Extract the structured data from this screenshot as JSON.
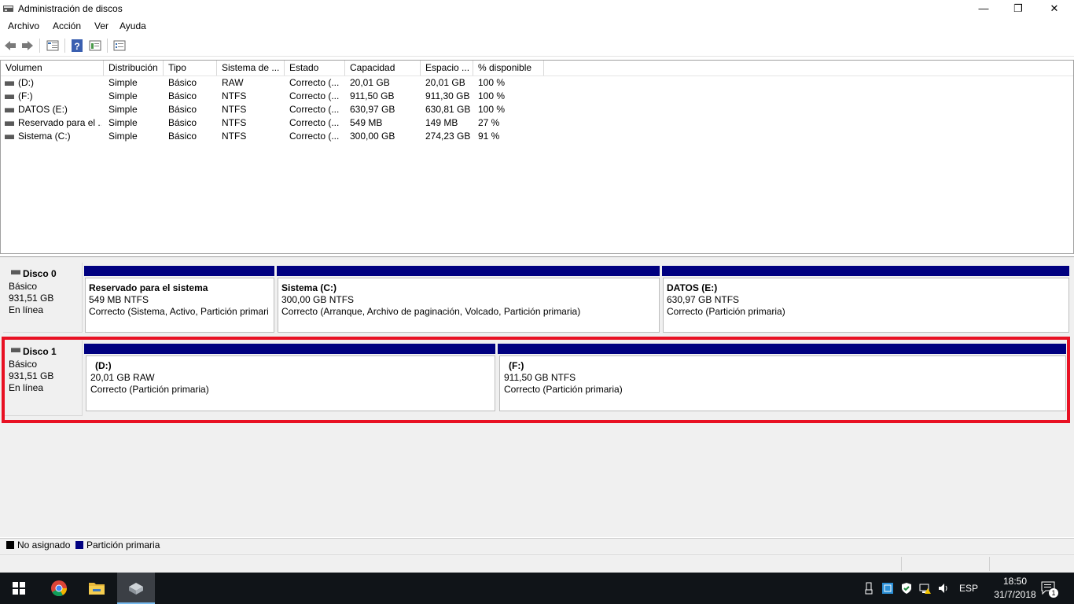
{
  "window": {
    "title": "Administración de discos",
    "minimize_glyph": "—",
    "maximize_glyph": "❐",
    "close_glyph": "✕"
  },
  "menu": {
    "items": [
      {
        "label": "Archivo"
      },
      {
        "label": "Acción"
      },
      {
        "label": "Ver"
      },
      {
        "label": "Ayuda"
      }
    ]
  },
  "toolbar": {
    "icons": [
      "back-arrow-icon",
      "forward-arrow-icon",
      "disk-list-icon",
      "help-icon",
      "properties-icon",
      "settings-list-icon"
    ]
  },
  "volume_list": {
    "columns": [
      "Volumen",
      "Distribución",
      "Tipo",
      "Sistema de ...",
      "Estado",
      "Capacidad",
      "Espacio ...",
      "% disponible"
    ],
    "rows": [
      {
        "volume": "(D:)",
        "layout": "Simple",
        "type": "Básico",
        "fs": "RAW",
        "status": "Correcto (...",
        "capacity": "20,01 GB",
        "free": "20,01 GB",
        "pct": "100 %"
      },
      {
        "volume": "(F:)",
        "layout": "Simple",
        "type": "Básico",
        "fs": "NTFS",
        "status": "Correcto (...",
        "capacity": "911,50 GB",
        "free": "911,30 GB",
        "pct": "100 %"
      },
      {
        "volume": "DATOS (E:)",
        "layout": "Simple",
        "type": "Básico",
        "fs": "NTFS",
        "status": "Correcto (...",
        "capacity": "630,97 GB",
        "free": "630,81 GB",
        "pct": "100 %"
      },
      {
        "volume": "Reservado para el ...",
        "layout": "Simple",
        "type": "Básico",
        "fs": "NTFS",
        "status": "Correcto (...",
        "capacity": "549 MB",
        "free": "149 MB",
        "pct": "27 %"
      },
      {
        "volume": "Sistema (C:)",
        "layout": "Simple",
        "type": "Básico",
        "fs": "NTFS",
        "status": "Correcto (...",
        "capacity": "300,00 GB",
        "free": "274,23 GB",
        "pct": "91 %"
      }
    ]
  },
  "disks": [
    {
      "name": "Disco 0",
      "type": "Básico",
      "size": "931,51 GB",
      "state": "En línea",
      "partitions": [
        {
          "name": "Reservado para el sistema",
          "size": "549 MB NTFS",
          "status": "Correcto (Sistema, Activo, Partición primari"
        },
        {
          "name": "Sistema  (C:)",
          "size": "300,00 GB NTFS",
          "status": "Correcto (Arranque, Archivo de paginación, Volcado, Partición primaria)"
        },
        {
          "name": "DATOS  (E:)",
          "size": "630,97 GB NTFS",
          "status": "Correcto (Partición primaria)"
        }
      ]
    },
    {
      "name": "Disco 1",
      "type": "Básico",
      "size": "931,51 GB",
      "state": "En línea",
      "partitions": [
        {
          "name": "(D:)",
          "size": "20,01 GB RAW",
          "status": "Correcto (Partición primaria)"
        },
        {
          "name": "(F:)",
          "size": "911,50 GB NTFS",
          "status": "Correcto (Partición primaria)"
        }
      ]
    }
  ],
  "legend": [
    {
      "label": "No asignado",
      "color": "#000000"
    },
    {
      "label": "Partición primaria",
      "color": "#000080"
    }
  ],
  "taskbar": {
    "apps": [
      "windows-start-icon",
      "chrome-icon",
      "file-explorer-icon",
      "disk-management-icon"
    ],
    "language": "ESP",
    "time": "18:50",
    "date": "31/7/2018",
    "notification_count": "1"
  },
  "colors": {
    "primary_partition": "#000080",
    "highlight": "#e81123",
    "taskbar": "#101418"
  }
}
